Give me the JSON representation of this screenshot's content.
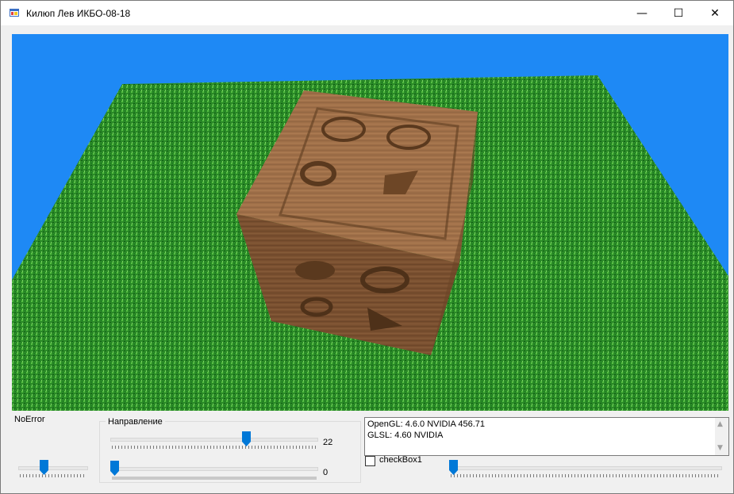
{
  "window": {
    "title": "Килюп Лев ИКБО-08-18",
    "controls": {
      "minimize": "—",
      "maximize": "☐",
      "close": "✕"
    }
  },
  "scene": {
    "sky_color": "#1e89f5",
    "grass_color": "#2f8f2a",
    "wood_color": "#9a6a42",
    "description_icons": [
      "wooden-cube",
      "grass-plane"
    ]
  },
  "status": {
    "error_label": "NoError"
  },
  "direction_group": {
    "caption": "Направление",
    "slider1_value": "22",
    "slider1_level": 0.66,
    "slider2_value": "0",
    "slider2_level": 0.0
  },
  "left_slider_level": 0.35,
  "info_box": {
    "line1": "OpenGL: 4.6.0 NVIDIA 456.71",
    "line2": "GLSL: 4.60 NVIDIA"
  },
  "checkbox": {
    "label": "checkBox1",
    "checked": false
  },
  "right_slider_level": 0.0,
  "colors": {
    "accent": "#0078d7",
    "window_bg": "#f0f0f0"
  }
}
